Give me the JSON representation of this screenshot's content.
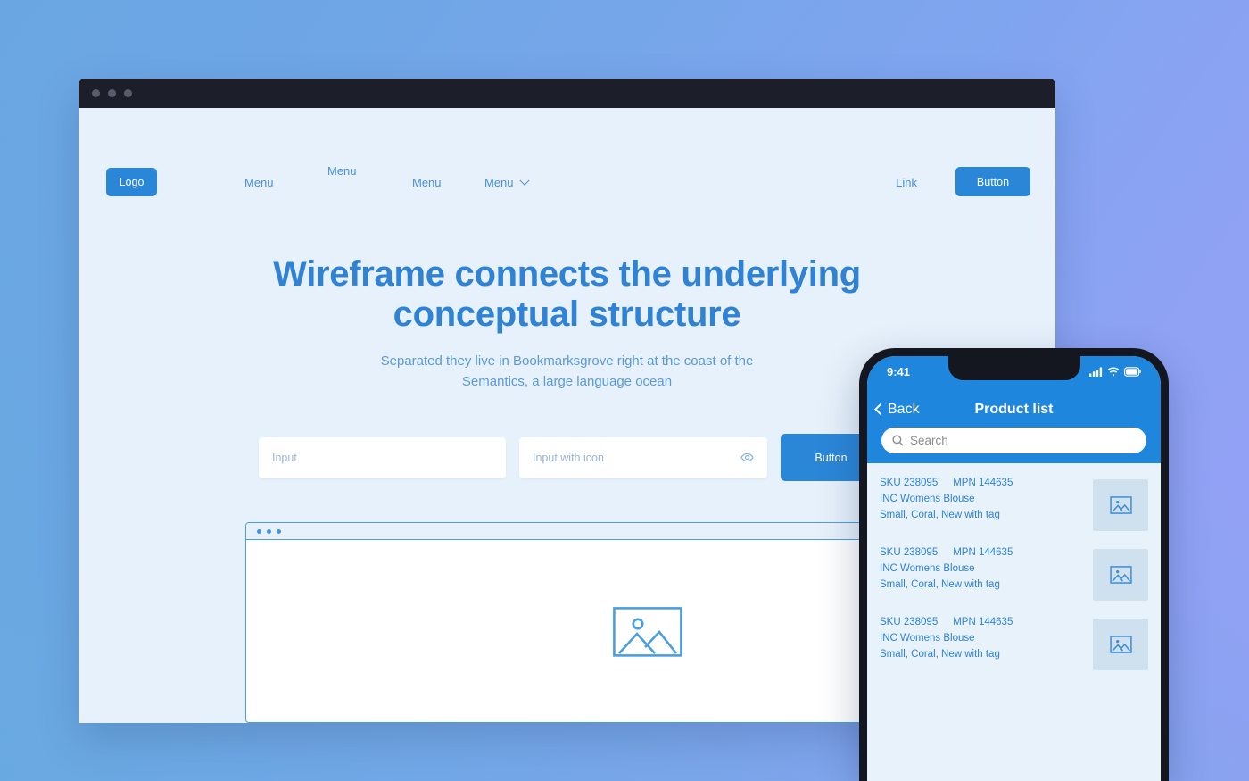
{
  "background": {
    "from": "#6aa7e2",
    "to": "#96a0f6"
  },
  "accent": "#2a87d8",
  "desktop": {
    "navbar": {
      "logo_label": "Logo",
      "menu_items": [
        {
          "label": "Menu"
        },
        {
          "label": "Menu"
        },
        {
          "label": "Menu"
        },
        {
          "label": "Menu",
          "icon": "chevron-down-icon"
        }
      ],
      "link_label": "Link",
      "button_label": "Button"
    },
    "hero": {
      "heading_line1": "Wireframe connects the underlying",
      "heading_line2": "conceptual structure",
      "sub_line1": "Separated they live in Bookmarksgrove right at the coast of the",
      "sub_line2": "Semantics, a large language ocean"
    },
    "form": {
      "input_placeholder": "Input",
      "input_icon_placeholder": "Input with icon",
      "input_icon": "eye-icon",
      "button_label": "Button"
    },
    "inner_window": {
      "placeholder_icon": "image-placeholder-icon"
    }
  },
  "phone": {
    "status": {
      "time": "9:41",
      "icons": [
        "signal-icon",
        "wifi-icon",
        "battery-icon"
      ]
    },
    "header": {
      "back_label": "Back",
      "title": "Product list"
    },
    "search": {
      "placeholder": "Search",
      "icon": "search-icon"
    },
    "products": [
      {
        "sku": "SKU 238095",
        "mpn": "MPN 144635",
        "name": "INC Womens Blouse",
        "attributes": "Small, Coral, New with tag",
        "thumb_icon": "image-placeholder-icon"
      },
      {
        "sku": "SKU 238095",
        "mpn": "MPN 144635",
        "name": "INC Womens Blouse",
        "attributes": "Small, Coral, New with tag",
        "thumb_icon": "image-placeholder-icon"
      },
      {
        "sku": "SKU 238095",
        "mpn": "MPN 144635",
        "name": "INC Womens Blouse",
        "attributes": "Small, Coral, New with tag",
        "thumb_icon": "image-placeholder-icon"
      }
    ]
  }
}
